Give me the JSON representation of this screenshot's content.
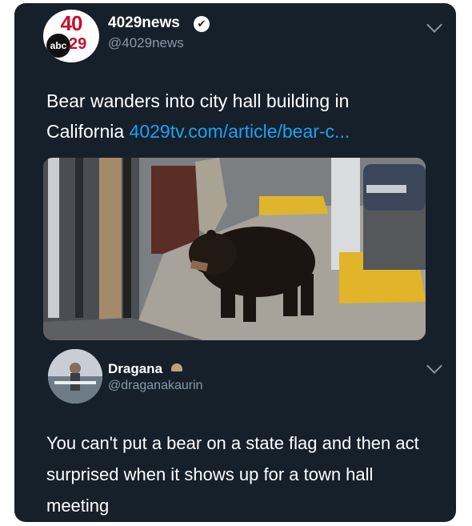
{
  "tweet": {
    "avatar": {
      "logo_number": "40",
      "logo_network": "abc",
      "logo_channel": "29"
    },
    "display_name": "4029news",
    "verified_glyph": "✔",
    "handle": "@4029news",
    "text": "Bear wanders into city hall building in California",
    "link_text": "4029tv.com/article/bear-c...",
    "media_icon": "photo-of-bear-on-sidewalk"
  },
  "reply": {
    "display_name": "Dragana",
    "handle": "@draganakaurin",
    "text": "You can't put a bear on a state flag and then act surprised when it shows up for a town hall meeting"
  },
  "icons": {
    "more_menu": "chevron-down-icon",
    "badge": "wing-icon"
  },
  "colors": {
    "background": "#15202b",
    "link": "#1da1f2",
    "secondary_text": "#8899a6"
  }
}
